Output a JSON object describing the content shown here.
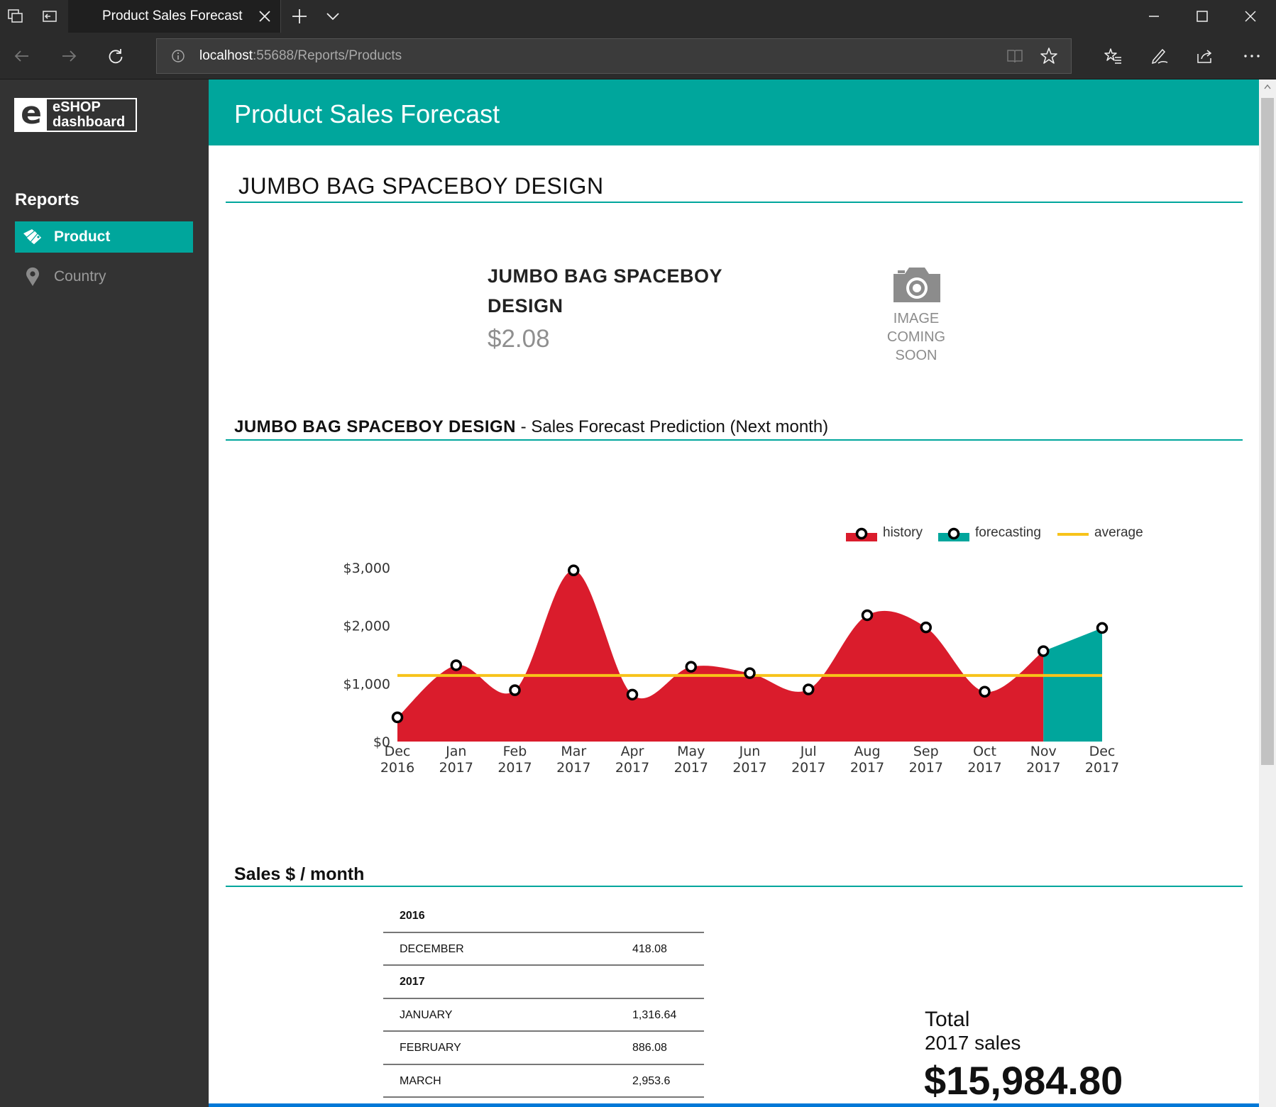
{
  "browser": {
    "tab_title": "Product Sales Forecast",
    "url_host": "localhost",
    "url_rest": ":55688/Reports/Products"
  },
  "sidebar": {
    "logo_line1": "eSHOP",
    "logo_line2": "dashboard",
    "logo_letter": "e",
    "heading": "Reports",
    "items": [
      {
        "label": "Product",
        "icon": "product-tags-icon",
        "active": true
      },
      {
        "label": "Country",
        "icon": "map-pin-icon",
        "active": false
      }
    ]
  },
  "header": {
    "title": "Product Sales Forecast"
  },
  "product": {
    "title": "JUMBO BAG SPACEBOY DESIGN",
    "name_line1": "JUMBO BAG SPACEBOY",
    "name_line2": "DESIGN",
    "price": "$2.08",
    "image_text": [
      "IMAGE",
      "COMING",
      "SOON"
    ]
  },
  "chart_section": {
    "heading_bold": "JUMBO BAG SPACEBOY DESIGN",
    "heading_rest": " - Sales Forecast Prediction (Next month)"
  },
  "chart_data": {
    "type": "area",
    "title": "JUMBO BAG SPACEBOY DESIGN - Sales Forecast Prediction (Next month)",
    "categories": [
      [
        "Dec",
        "2016"
      ],
      [
        "Jan",
        "2017"
      ],
      [
        "Feb",
        "2017"
      ],
      [
        "Mar",
        "2017"
      ],
      [
        "Apr",
        "2017"
      ],
      [
        "May",
        "2017"
      ],
      [
        "Jun",
        "2017"
      ],
      [
        "Jul",
        "2017"
      ],
      [
        "Aug",
        "2017"
      ],
      [
        "Sep",
        "2017"
      ],
      [
        "Oct",
        "2017"
      ],
      [
        "Nov",
        "2017"
      ],
      [
        "Dec",
        "2017"
      ]
    ],
    "series": [
      {
        "name": "history",
        "color": "#da1c2c",
        "values": [
          418.08,
          1316.64,
          886.08,
          2953.6,
          810,
          1290,
          1180,
          900,
          2180,
          1970,
          860,
          1560,
          null
        ]
      },
      {
        "name": "forecasting",
        "color": "#00a69c",
        "values": [
          null,
          null,
          null,
          null,
          null,
          null,
          null,
          null,
          null,
          null,
          null,
          1560,
          1960
        ]
      },
      {
        "name": "average",
        "color": "#f7c31a",
        "values": [
          1140,
          1140,
          1140,
          1140,
          1140,
          1140,
          1140,
          1140,
          1140,
          1140,
          1140,
          1140,
          1140
        ]
      }
    ],
    "y_ticks": [
      "$0",
      "$1,000",
      "$2,000",
      "$3,000"
    ],
    "y_tick_values": [
      0,
      1000,
      2000,
      3000
    ],
    "ylim": [
      0,
      3000
    ],
    "legend_position": "top-right",
    "grid": false
  },
  "sales": {
    "heading": "Sales $ / month",
    "rows": [
      {
        "type": "year",
        "label": "2016",
        "value": ""
      },
      {
        "type": "month",
        "label": "DECEMBER",
        "value": "418.08"
      },
      {
        "type": "year",
        "label": "2017",
        "value": ""
      },
      {
        "type": "month",
        "label": "JANUARY",
        "value": "1,316.64"
      },
      {
        "type": "month",
        "label": "FEBRUARY",
        "value": "886.08"
      },
      {
        "type": "month",
        "label": "MARCH",
        "value": "2,953.6"
      }
    ],
    "total_line1": "Total",
    "total_line2": "2017 sales",
    "total_value": "$15,984.80"
  }
}
